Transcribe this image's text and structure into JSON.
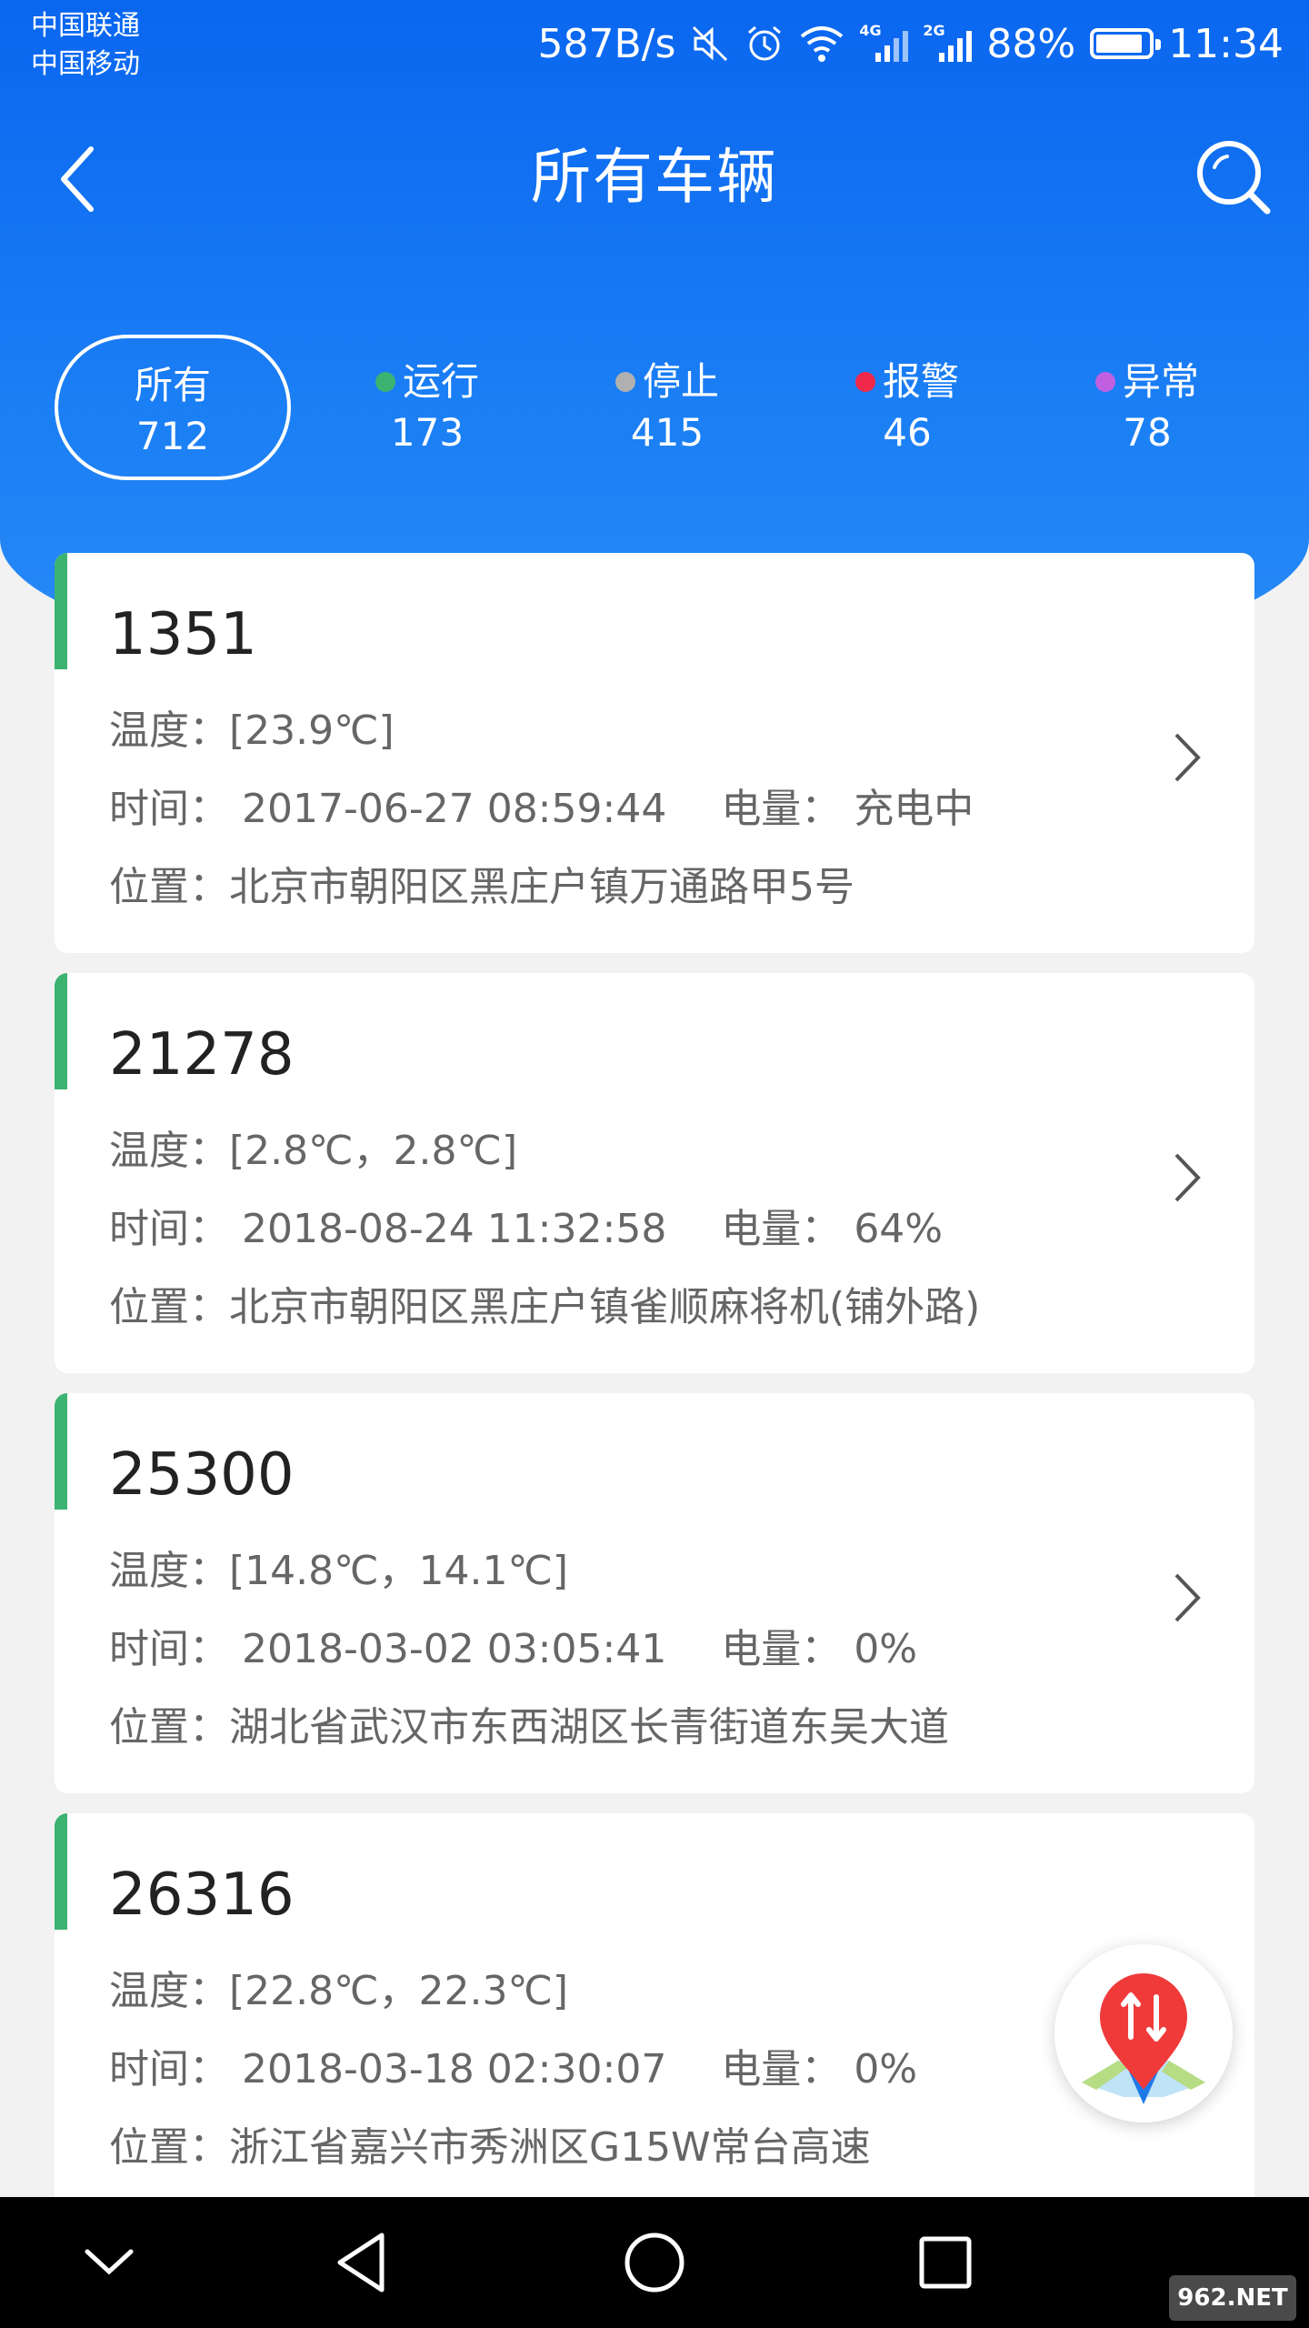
{
  "status_bar": {
    "carrier_1": "中国联通",
    "carrier_2": "中国移动",
    "net_speed": "587B/s",
    "signal_1_tag": "4G",
    "signal_2_tag": "2G",
    "battery_percent": "88%",
    "battery_level": 0.88,
    "time": "11:34",
    "icons": [
      "mute-icon",
      "alarm-icon",
      "wifi-icon",
      "signal-icon",
      "battery-icon"
    ]
  },
  "header": {
    "title": "所有车辆"
  },
  "tabs": [
    {
      "label": "所有",
      "count": "712",
      "dot_color": ""
    },
    {
      "label": "运行",
      "count": "173",
      "dot_color": "#3cb371"
    },
    {
      "label": "停止",
      "count": "415",
      "dot_color": "#b0b0b0"
    },
    {
      "label": "报警",
      "count": "46",
      "dot_color": "#f0294a"
    },
    {
      "label": "异常",
      "count": "78",
      "dot_color": "#c060e0"
    }
  ],
  "labels": {
    "temperature": "温度：",
    "time": "时间：",
    "battery": "电量：",
    "location": "位置："
  },
  "vehicles": [
    {
      "id": "1351",
      "temperature": "[23.9℃]",
      "time": "2017-06-27 08:59:44",
      "battery": "充电中",
      "location": "北京市朝阳区黑庄户镇万通路甲5号"
    },
    {
      "id": "21278",
      "temperature": "[2.8℃，2.8℃]",
      "time": "2018-08-24 11:32:58",
      "battery": "64%",
      "location": "北京市朝阳区黑庄户镇雀顺麻将机(铺外路)"
    },
    {
      "id": "25300",
      "temperature": "[14.8℃，14.1℃]",
      "time": "2018-03-02 03:05:41",
      "battery": "0%",
      "location": "湖北省武汉市东西湖区长青街道东吴大道"
    },
    {
      "id": "26316",
      "temperature": "[22.8℃，22.3℃]",
      "time": "2018-03-18 02:30:07",
      "battery": "0%",
      "location": "浙江省嘉兴市秀洲区G15W常台高速"
    }
  ],
  "colors": {
    "header_blue": "#0a66ef",
    "accent_green": "#3cb371",
    "pin_red": "#f03a3a"
  },
  "watermark": "962.NET"
}
